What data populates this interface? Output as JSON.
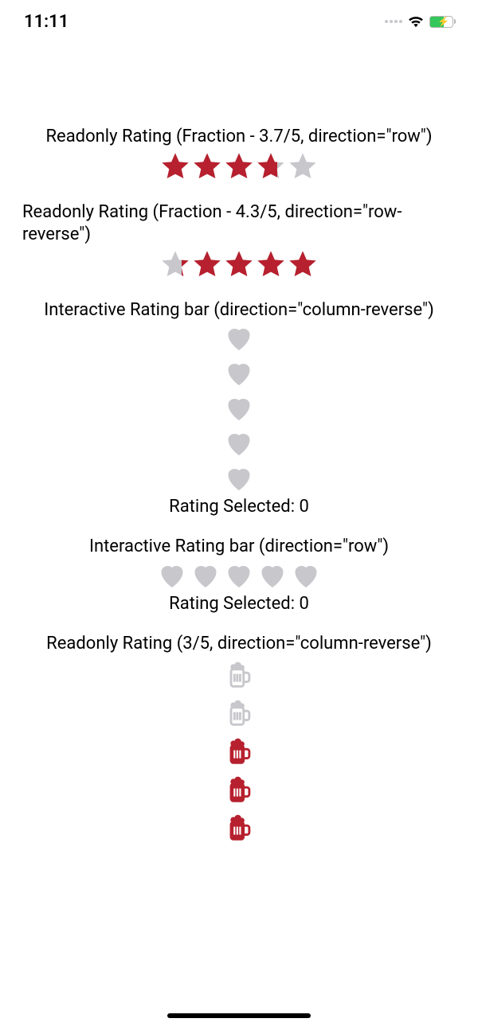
{
  "status": {
    "time": "11:11"
  },
  "colors": {
    "filled": "#b7202e",
    "empty": "#c7c7cc"
  },
  "sections": {
    "readonlyRow": {
      "title": "Readonly Rating (Fraction - 3.7/5, direction=\"row\")",
      "max": 5,
      "value": 3.7
    },
    "readonlyRowReverse": {
      "title": "Readonly Rating (Fraction - 4.3/5, direction=\"row-reverse\")",
      "max": 5,
      "value": 4.3
    },
    "interactiveColReverse": {
      "title": "Interactive Rating bar (direction=\"column-reverse\")",
      "max": 5,
      "selected": 0,
      "selectedLabel": "Rating Selected: 0"
    },
    "interactiveRow": {
      "title": "Interactive Rating bar (direction=\"row\")",
      "max": 5,
      "selected": 0,
      "selectedLabel": "Rating Selected: 0"
    },
    "readonlyColReverseBeer": {
      "title": "Readonly Rating (3/5, direction=\"column-reverse\")",
      "max": 5,
      "value": 3
    }
  }
}
